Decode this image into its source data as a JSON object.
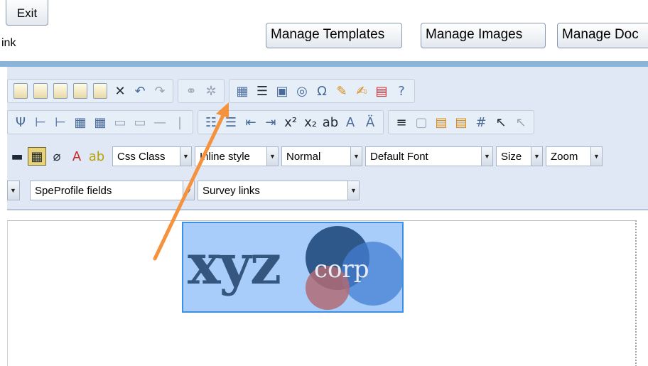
{
  "header": {
    "exit_label": "Exit",
    "blank_label": "ink",
    "manage_templates": "Manage Templates",
    "manage_images": "Manage Images",
    "manage_docs": "Manage Doc"
  },
  "toolbar": {
    "row3": {
      "css_class": "Css Class",
      "inline_style": "Inline style",
      "format": "Normal",
      "font": "Default Font",
      "size": "Size",
      "zoom": "Zoom"
    },
    "row4": {
      "profile_fields": "SpeProfile fields",
      "survey_links": "Survey links"
    }
  },
  "logo": {
    "text_main": "xyz",
    "text_sub": "corp"
  },
  "colors": {
    "toolbar_bg": "#dfe8f4",
    "band": "#8cb4d9",
    "annotation_arrow": "#f5923e",
    "logo_bg": "#a9cdfa"
  },
  "icons": {
    "row1": [
      "copy-icon",
      "paste-icon",
      "paste-text-icon",
      "paste-word-icon",
      "paste-html-icon",
      "delete-icon",
      "undo-icon",
      "redo-icon",
      "link-icon",
      "unlink-icon",
      "find-icon",
      "spellcheck-icon",
      "form-icon",
      "anchor-icon",
      "special-char-icon",
      "stamp-icon",
      "edit-icon",
      "pdf-icon",
      "help-icon"
    ],
    "row2": [
      "insert-row-icon",
      "insert-col-icon",
      "split-cell-icon",
      "table-icon",
      "table-props-icon",
      "merge-icon",
      "cell-icon",
      "hr-icon",
      "pipe-icon",
      "ordered-list-icon",
      "unordered-list-icon",
      "outdent-icon",
      "indent-icon",
      "superscript-icon",
      "subscript-icon",
      "strike-icon",
      "grow-font-icon",
      "shrink-font-icon",
      "justify-icon",
      "box-icon",
      "copy-style-icon",
      "paste-style-icon",
      "grid-icon",
      "cursor-icon",
      "select-icon"
    ]
  }
}
